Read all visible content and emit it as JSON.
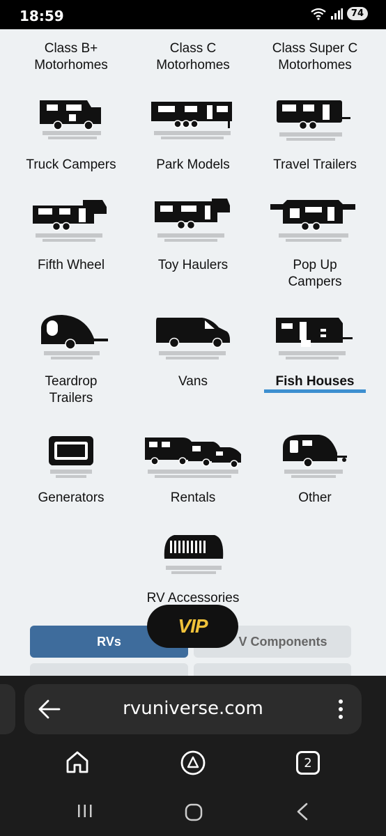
{
  "status_bar": {
    "time": "18:59",
    "battery": "74",
    "icons": [
      "wifi-icon",
      "signal-icon",
      "battery-icon"
    ]
  },
  "categories": {
    "row0": [
      {
        "label": "Class B+\nMotorhomes",
        "line1": "Class B+",
        "line2": "Motorhomes"
      },
      {
        "label": "Class C\nMotorhomes",
        "line1": "Class C",
        "line2": "Motorhomes"
      },
      {
        "label": "Class Super C\nMotorhomes",
        "line1": "Class Super C",
        "line2": "Motorhomes"
      }
    ],
    "row1": [
      "Truck Campers",
      "Park Models",
      "Travel Trailers"
    ],
    "row2": {
      "a": "Fifth Wheel",
      "b": "Toy Haulers",
      "c1": "Pop Up",
      "c2": "Campers"
    },
    "row3": {
      "a1": "Teardrop",
      "a2": "Trailers",
      "b": "Vans",
      "c": "Fish Houses"
    },
    "row4": [
      "Generators",
      "Rentals",
      "Other"
    ],
    "row5": "RV Accessories",
    "selected": "Fish Houses"
  },
  "vip": {
    "label": "VIP",
    "color": "#f0c23a"
  },
  "tabs": {
    "rvs": "RVs",
    "components": "V Components"
  },
  "browser": {
    "url": "rvuniverse.com",
    "tab_count": "2"
  },
  "colors": {
    "accent": "#3e6c9c",
    "underline": "#3d8fd0",
    "background": "#eef1f3"
  }
}
